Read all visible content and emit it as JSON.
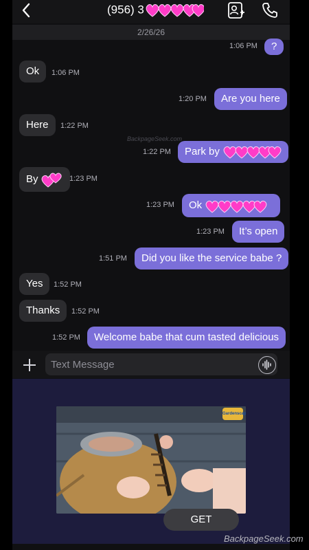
{
  "header": {
    "title": "(956) 3",
    "back_icon": "chevron-left-icon",
    "contact_icon": "add-contact-icon",
    "call_icon": "phone-icon"
  },
  "date_separator": "2/26/26",
  "messages": [
    {
      "dir": "out",
      "text": "?",
      "time": "1:06 PM"
    },
    {
      "dir": "in",
      "text": "Ok",
      "time": "1:06 PM"
    },
    {
      "dir": "out",
      "text": "Are you here",
      "time": "1:20 PM"
    },
    {
      "dir": "in",
      "text": "Here",
      "time": "1:22 PM"
    },
    {
      "dir": "out",
      "text": "Park by",
      "time": "1:22 PM"
    },
    {
      "dir": "in",
      "text": "By",
      "time": "1:23 PM"
    },
    {
      "dir": "out",
      "text": "Ok",
      "time": "1:23 PM"
    },
    {
      "dir": "out",
      "text": "It’s open",
      "time": "1:23 PM"
    },
    {
      "dir": "out",
      "text": "Did you like the service babe ?",
      "time": "1:51 PM"
    },
    {
      "dir": "in",
      "text": "Yes",
      "time": "1:52 PM"
    },
    {
      "dir": "in",
      "text": "Thanks",
      "time": "1:52 PM"
    },
    {
      "dir": "out",
      "text": "Welcome babe that cum tasted delicious",
      "time": "1:52 PM"
    }
  ],
  "watermark": "BackpageSeek.com",
  "composer": {
    "placeholder": "Text Message"
  },
  "ad": {
    "cta": "GET",
    "logo_text": "Gardenscapes"
  },
  "footer": {
    "brand": "BackpageSeek.com"
  },
  "colors": {
    "outgoing": "#7b6fd9",
    "incoming": "#2c2c2f",
    "heart": "#ff3cc8"
  }
}
